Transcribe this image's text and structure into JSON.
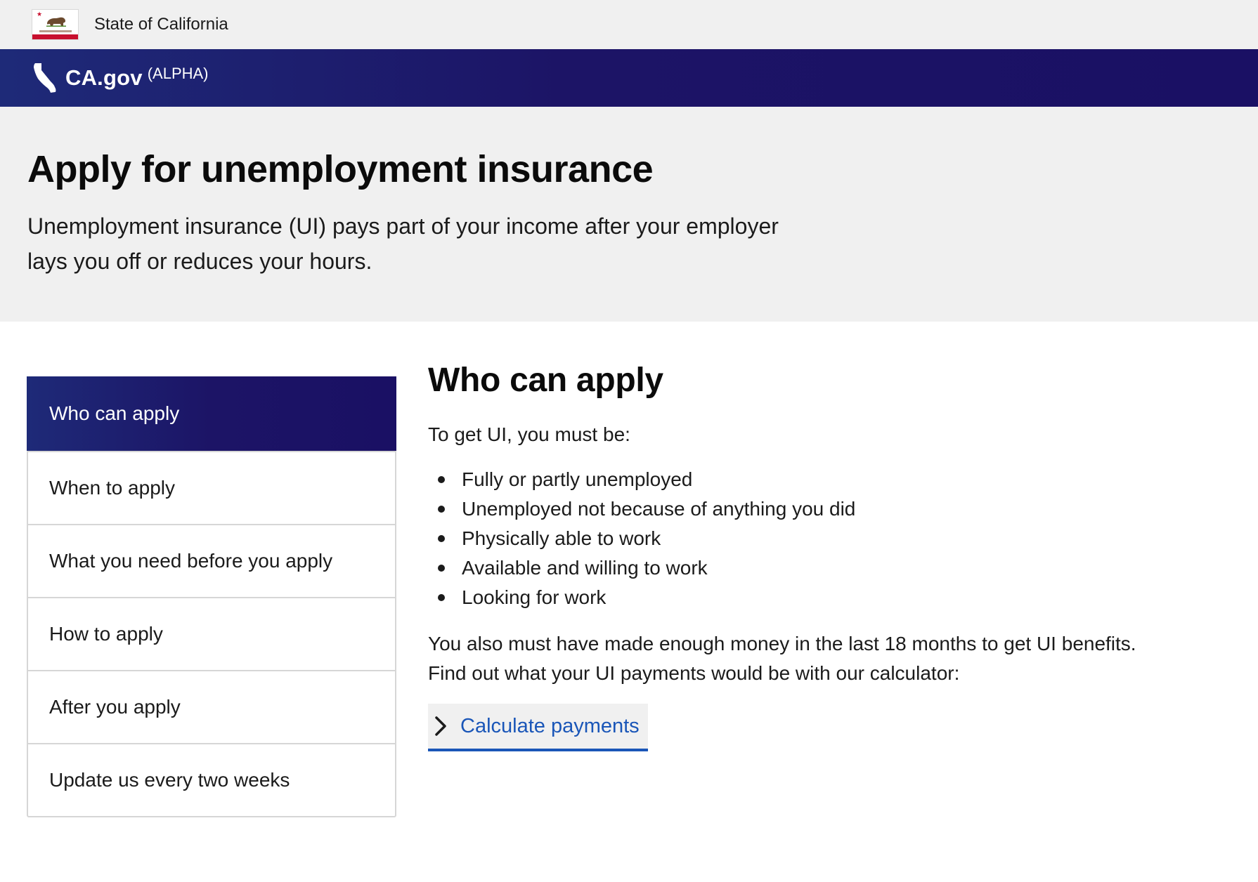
{
  "utility": {
    "state_name": "State of California"
  },
  "header": {
    "brand": "CA.gov",
    "tag": "(ALPHA)"
  },
  "hero": {
    "title": "Apply for unemployment insurance",
    "intro": "Unemployment insurance (UI) pays part of your income after your employer lays you off or reduces your hours."
  },
  "sidenav": {
    "items": [
      {
        "label": "Who can apply",
        "active": true
      },
      {
        "label": "When to apply",
        "active": false
      },
      {
        "label": "What you need before you apply",
        "active": false
      },
      {
        "label": "How to apply",
        "active": false
      },
      {
        "label": "After you apply",
        "active": false
      },
      {
        "label": "Update us every two weeks",
        "active": false
      }
    ]
  },
  "content": {
    "title": "Who can apply",
    "lead": "To get UI, you must be:",
    "requirements": [
      "Fully or partly unemployed",
      "Unemployed not because of anything you did",
      "Physically able to work",
      "Available and willing to work",
      "Looking for work"
    ],
    "note_line1": "You also must have made enough money in the last 18 months to get UI benefits.",
    "note_line2": "Find out what your UI payments would be with our calculator:",
    "cta_label": "Calculate payments"
  },
  "colors": {
    "header_navy": "#1c1466",
    "link_blue": "#1a56b8",
    "hero_gray": "#f0f0f0",
    "flag_red": "#c8102e"
  },
  "icons": {
    "flag": "california-flag-icon",
    "state_outline": "california-outline-icon",
    "chevron": "chevron-right-icon"
  }
}
